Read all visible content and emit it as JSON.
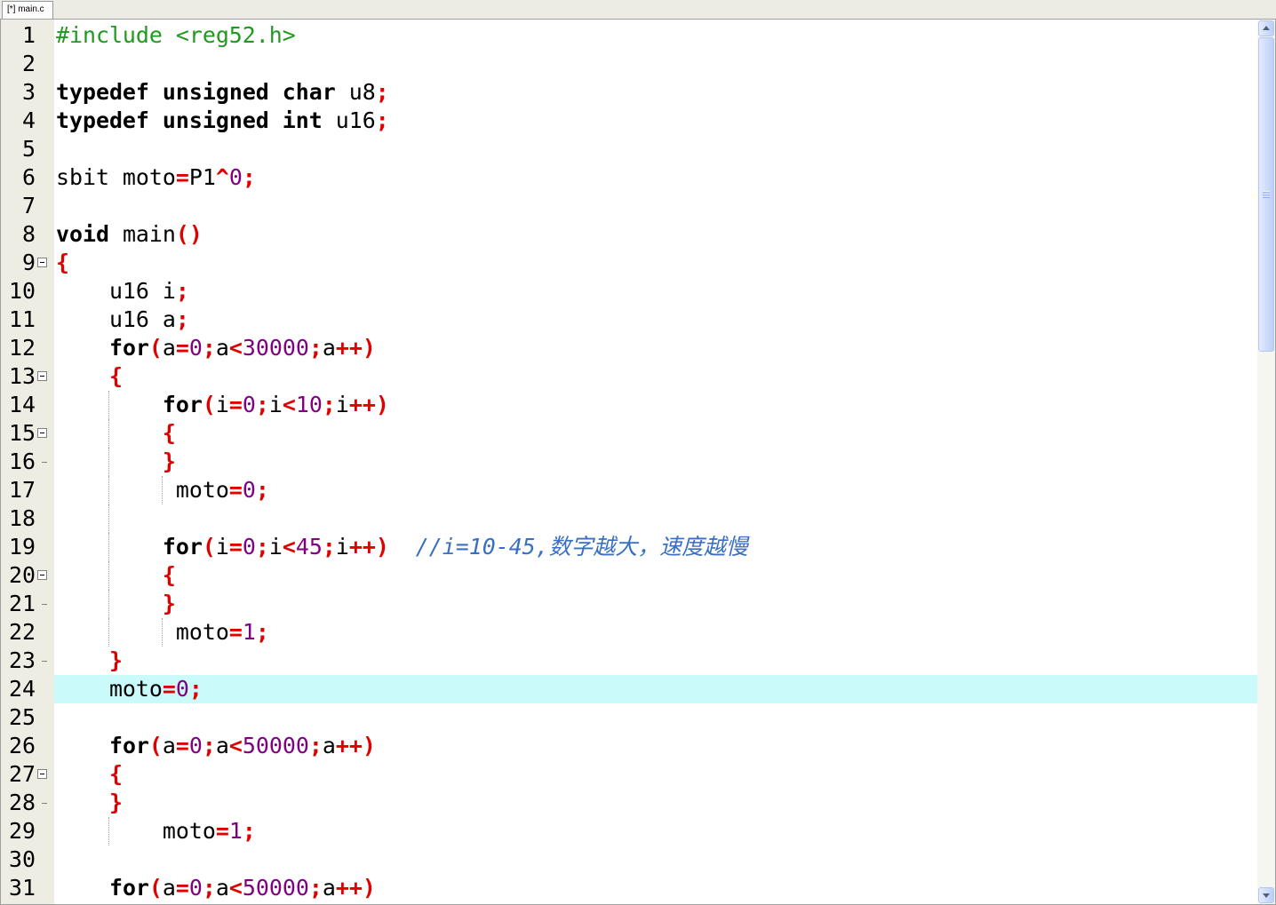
{
  "window": {
    "tab_label": "[*] main.c"
  },
  "editor": {
    "current_line": 24,
    "current_line_bg": "#cafafa",
    "lines": [
      {
        "num": "1",
        "tokens": [
          {
            "v": "#include <reg52.h>",
            "c": "#1e9a1e"
          }
        ]
      },
      {
        "num": "2",
        "tokens": []
      },
      {
        "num": "3",
        "tokens": [
          {
            "v": "typedef",
            "c": "#000000",
            "b": true
          },
          {
            "v": " ",
            "c": "#000000"
          },
          {
            "v": "unsigned",
            "c": "#000000",
            "b": true
          },
          {
            "v": " ",
            "c": "#000000"
          },
          {
            "v": "char",
            "c": "#000000",
            "b": true
          },
          {
            "v": " u8",
            "c": "#000000"
          },
          {
            "v": ";",
            "c": "#e00000",
            "b": true
          }
        ]
      },
      {
        "num": "4",
        "tokens": [
          {
            "v": "typedef",
            "c": "#000000",
            "b": true
          },
          {
            "v": " ",
            "c": "#000000"
          },
          {
            "v": "unsigned",
            "c": "#000000",
            "b": true
          },
          {
            "v": " ",
            "c": "#000000"
          },
          {
            "v": "int",
            "c": "#000000",
            "b": true
          },
          {
            "v": " u16",
            "c": "#000000"
          },
          {
            "v": ";",
            "c": "#e00000",
            "b": true
          }
        ]
      },
      {
        "num": "5",
        "tokens": []
      },
      {
        "num": "6",
        "tokens": [
          {
            "v": "sbit moto",
            "c": "#000000"
          },
          {
            "v": "=",
            "c": "#e00000",
            "b": true
          },
          {
            "v": "P1",
            "c": "#000000"
          },
          {
            "v": "^",
            "c": "#e00000",
            "b": true
          },
          {
            "v": "0",
            "c": "#800080"
          },
          {
            "v": ";",
            "c": "#e00000",
            "b": true
          }
        ]
      },
      {
        "num": "7",
        "tokens": []
      },
      {
        "num": "8",
        "tokens": [
          {
            "v": "void",
            "c": "#000000",
            "b": true
          },
          {
            "v": " main",
            "c": "#000000"
          },
          {
            "v": "()",
            "c": "#e00000",
            "b": true
          }
        ]
      },
      {
        "num": "9",
        "fold": "fold-open-icon",
        "tokens": [
          {
            "v": "{",
            "c": "#e00000",
            "b": true
          }
        ]
      },
      {
        "num": "10",
        "tokens": [
          {
            "v": "    u16 i",
            "c": "#000000"
          },
          {
            "v": ";",
            "c": "#e00000",
            "b": true
          }
        ]
      },
      {
        "num": "11",
        "tokens": [
          {
            "v": "    u16 a",
            "c": "#000000"
          },
          {
            "v": ";",
            "c": "#e00000",
            "b": true
          }
        ]
      },
      {
        "num": "12",
        "tokens": [
          {
            "v": "    ",
            "c": "#000000"
          },
          {
            "v": "for",
            "c": "#000000",
            "b": true
          },
          {
            "v": "(",
            "c": "#e00000",
            "b": true
          },
          {
            "v": "a",
            "c": "#000000"
          },
          {
            "v": "=",
            "c": "#e00000",
            "b": true
          },
          {
            "v": "0",
            "c": "#800080"
          },
          {
            "v": ";",
            "c": "#e00000",
            "b": true
          },
          {
            "v": "a",
            "c": "#000000"
          },
          {
            "v": "<",
            "c": "#e00000",
            "b": true
          },
          {
            "v": "30000",
            "c": "#800080"
          },
          {
            "v": ";",
            "c": "#e00000",
            "b": true
          },
          {
            "v": "a",
            "c": "#000000"
          },
          {
            "v": "++)",
            "c": "#e00000",
            "b": true
          }
        ]
      },
      {
        "num": "13",
        "fold": "fold-open-icon",
        "tokens": [
          {
            "v": "    ",
            "c": "#000000"
          },
          {
            "v": "{",
            "c": "#e00000",
            "b": true
          }
        ]
      },
      {
        "num": "14",
        "tokens": [
          {
            "v": "        ",
            "c": "#000000"
          },
          {
            "v": "for",
            "c": "#000000",
            "b": true
          },
          {
            "v": "(",
            "c": "#e00000",
            "b": true
          },
          {
            "v": "i",
            "c": "#000000"
          },
          {
            "v": "=",
            "c": "#e00000",
            "b": true
          },
          {
            "v": "0",
            "c": "#800080"
          },
          {
            "v": ";",
            "c": "#e00000",
            "b": true
          },
          {
            "v": "i",
            "c": "#000000"
          },
          {
            "v": "<",
            "c": "#e00000",
            "b": true
          },
          {
            "v": "10",
            "c": "#800080"
          },
          {
            "v": ";",
            "c": "#e00000",
            "b": true
          },
          {
            "v": "i",
            "c": "#000000"
          },
          {
            "v": "++)",
            "c": "#e00000",
            "b": true
          }
        ]
      },
      {
        "num": "15",
        "fold": "fold-open-icon",
        "tokens": [
          {
            "v": "        ",
            "c": "#000000"
          },
          {
            "v": "{",
            "c": "#e00000",
            "b": true
          }
        ]
      },
      {
        "num": "16",
        "fold": "fold-end-icon",
        "tokens": [
          {
            "v": "        ",
            "c": "#000000"
          },
          {
            "v": "}",
            "c": "#e00000",
            "b": true
          }
        ]
      },
      {
        "num": "17",
        "tokens": [
          {
            "v": "         moto",
            "c": "#000000"
          },
          {
            "v": "=",
            "c": "#e00000",
            "b": true
          },
          {
            "v": "0",
            "c": "#800080"
          },
          {
            "v": ";",
            "c": "#e00000",
            "b": true
          }
        ]
      },
      {
        "num": "18",
        "tokens": []
      },
      {
        "num": "19",
        "tokens": [
          {
            "v": "        ",
            "c": "#000000"
          },
          {
            "v": "for",
            "c": "#000000",
            "b": true
          },
          {
            "v": "(",
            "c": "#e00000",
            "b": true
          },
          {
            "v": "i",
            "c": "#000000"
          },
          {
            "v": "=",
            "c": "#e00000",
            "b": true
          },
          {
            "v": "0",
            "c": "#800080"
          },
          {
            "v": ";",
            "c": "#e00000",
            "b": true
          },
          {
            "v": "i",
            "c": "#000000"
          },
          {
            "v": "<",
            "c": "#e00000",
            "b": true
          },
          {
            "v": "45",
            "c": "#800080"
          },
          {
            "v": ";",
            "c": "#e00000",
            "b": true
          },
          {
            "v": "i",
            "c": "#000000"
          },
          {
            "v": "++)",
            "c": "#e00000",
            "b": true
          },
          {
            "v": "  ",
            "c": "#000000"
          },
          {
            "v": "//i=10-45,数字越大，速度越慢",
            "c": "#3a70c2",
            "i": true
          }
        ]
      },
      {
        "num": "20",
        "fold": "fold-open-icon",
        "tokens": [
          {
            "v": "        ",
            "c": "#000000"
          },
          {
            "v": "{",
            "c": "#e00000",
            "b": true
          }
        ]
      },
      {
        "num": "21",
        "fold": "fold-end-icon",
        "tokens": [
          {
            "v": "        ",
            "c": "#000000"
          },
          {
            "v": "}",
            "c": "#e00000",
            "b": true
          }
        ]
      },
      {
        "num": "22",
        "tokens": [
          {
            "v": "         moto",
            "c": "#000000"
          },
          {
            "v": "=",
            "c": "#e00000",
            "b": true
          },
          {
            "v": "1",
            "c": "#800080"
          },
          {
            "v": ";",
            "c": "#e00000",
            "b": true
          }
        ]
      },
      {
        "num": "23",
        "fold": "fold-end-icon",
        "tokens": [
          {
            "v": "    ",
            "c": "#000000"
          },
          {
            "v": "}",
            "c": "#e00000",
            "b": true
          }
        ]
      },
      {
        "num": "24",
        "tokens": [
          {
            "v": "    moto",
            "c": "#000000"
          },
          {
            "v": "=",
            "c": "#e00000",
            "b": true
          },
          {
            "v": "0",
            "c": "#800080"
          },
          {
            "v": ";",
            "c": "#e00000",
            "b": true
          }
        ]
      },
      {
        "num": "25",
        "tokens": []
      },
      {
        "num": "26",
        "tokens": [
          {
            "v": "    ",
            "c": "#000000"
          },
          {
            "v": "for",
            "c": "#000000",
            "b": true
          },
          {
            "v": "(",
            "c": "#e00000",
            "b": true
          },
          {
            "v": "a",
            "c": "#000000"
          },
          {
            "v": "=",
            "c": "#e00000",
            "b": true
          },
          {
            "v": "0",
            "c": "#800080"
          },
          {
            "v": ";",
            "c": "#e00000",
            "b": true
          },
          {
            "v": "a",
            "c": "#000000"
          },
          {
            "v": "<",
            "c": "#e00000",
            "b": true
          },
          {
            "v": "50000",
            "c": "#800080"
          },
          {
            "v": ";",
            "c": "#e00000",
            "b": true
          },
          {
            "v": "a",
            "c": "#000000"
          },
          {
            "v": "++)",
            "c": "#e00000",
            "b": true
          }
        ]
      },
      {
        "num": "27",
        "fold": "fold-open-icon",
        "tokens": [
          {
            "v": "    ",
            "c": "#000000"
          },
          {
            "v": "{",
            "c": "#e00000",
            "b": true
          }
        ]
      },
      {
        "num": "28",
        "fold": "fold-end-icon",
        "tokens": [
          {
            "v": "    ",
            "c": "#000000"
          },
          {
            "v": "}",
            "c": "#e00000",
            "b": true
          }
        ]
      },
      {
        "num": "29",
        "tokens": [
          {
            "v": "        moto",
            "c": "#000000"
          },
          {
            "v": "=",
            "c": "#e00000",
            "b": true
          },
          {
            "v": "1",
            "c": "#800080"
          },
          {
            "v": ";",
            "c": "#e00000",
            "b": true
          }
        ]
      },
      {
        "num": "30",
        "tokens": []
      },
      {
        "num": "31",
        "tokens": [
          {
            "v": "    ",
            "c": "#000000"
          },
          {
            "v": "for",
            "c": "#000000",
            "b": true
          },
          {
            "v": "(",
            "c": "#e00000",
            "b": true
          },
          {
            "v": "a",
            "c": "#000000"
          },
          {
            "v": "=",
            "c": "#e00000",
            "b": true
          },
          {
            "v": "0",
            "c": "#800080"
          },
          {
            "v": ";",
            "c": "#e00000",
            "b": true
          },
          {
            "v": "a",
            "c": "#000000"
          },
          {
            "v": "<",
            "c": "#e00000",
            "b": true
          },
          {
            "v": "50000",
            "c": "#800080"
          },
          {
            "v": ";",
            "c": "#e00000",
            "b": true
          },
          {
            "v": "a",
            "c": "#000000"
          },
          {
            "v": "++)",
            "c": "#e00000",
            "b": true
          }
        ]
      }
    ]
  },
  "scrollbar": {
    "position": 0,
    "visible_fraction": 0.37
  }
}
